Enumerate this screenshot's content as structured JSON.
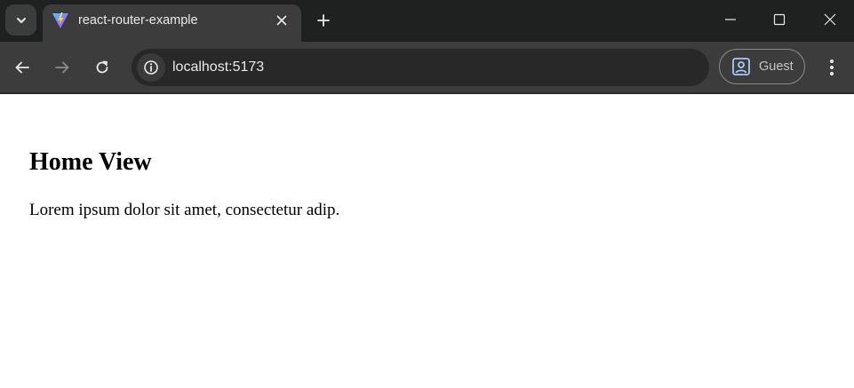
{
  "browser": {
    "tab": {
      "title": "react-router-example",
      "favicon": "vite-logo-icon"
    },
    "address_bar": {
      "url": "localhost:5173"
    },
    "profile": {
      "label": "Guest"
    },
    "icons": {
      "tab_search": "chevron-down-icon",
      "tab_close": "close-icon",
      "new_tab": "plus-icon",
      "minimize": "minimize-icon",
      "maximize": "maximize-icon",
      "close_window": "close-icon",
      "back": "arrow-left-icon",
      "forward": "arrow-right-icon",
      "reload": "reload-icon",
      "site_info": "info-icon",
      "profile": "person-icon",
      "menu": "kebab-menu-icon"
    },
    "colors": {
      "tabstrip": "#1f2020",
      "toolbar": "#3c3c3c",
      "omnibox": "#282828",
      "text": "#e8eaed",
      "profile_accent": "#a8c7fa"
    }
  },
  "page": {
    "heading": "Home View",
    "paragraph": "Lorem ipsum dolor sit amet, consectetur adip."
  }
}
